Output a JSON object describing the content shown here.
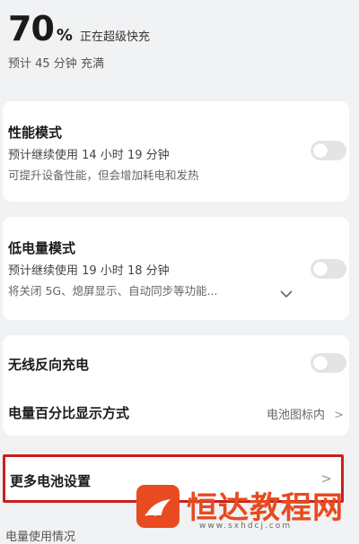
{
  "charge": {
    "percent": "70",
    "percent_sign": "%",
    "status": "正在超级快充",
    "eta": "预计 45 分钟 充满"
  },
  "performance": {
    "title": "性能模式",
    "estimate": "预计继续使用 14 小时 19 分钟",
    "desc": "可提升设备性能，但会增加耗电和发热",
    "enabled": false
  },
  "low_power": {
    "title": "低电量模式",
    "estimate": "预计继续使用 19 小时 18 分钟",
    "desc": "将关闭 5G、熄屏显示、自动同步等功能...",
    "expand_icon": "chevron-down-icon",
    "enabled": false
  },
  "wireless": {
    "title": "无线反向充电",
    "enabled": false
  },
  "percent_display": {
    "title": "电量百分比显示方式",
    "value": "电池图标内",
    "chevron": ">"
  },
  "more_settings": {
    "title": "更多电池设置",
    "chevron": ">"
  },
  "section_partial": "电量使用情况",
  "watermark": {
    "text": "恒达教程网",
    "url": "www.sxhdcj.com",
    "color": "#e74b1f"
  },
  "colors": {
    "highlight": "#c8201e",
    "toggle_off": "#e4e4e6"
  }
}
